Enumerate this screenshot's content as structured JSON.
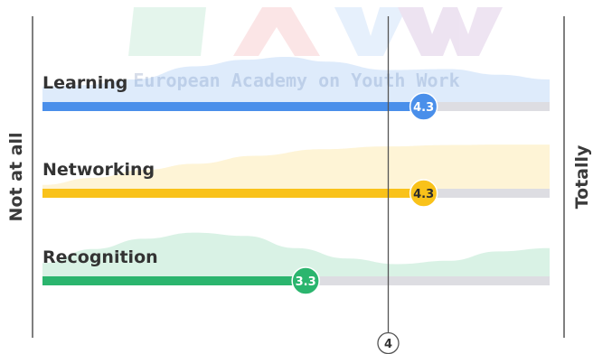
{
  "watermark": {
    "logo_letters": "EAYW",
    "text": "European Academy on Youth Work"
  },
  "axis": {
    "left_label": "Not at all",
    "right_label": "Totally",
    "reference_value": "4"
  },
  "colors": {
    "learning": "#4a8fea",
    "networking": "#f9c21a",
    "recognition": "#2bb56e",
    "track": "#dddde2",
    "axis": "#555555"
  },
  "chart_data": {
    "type": "bar",
    "orientation": "horizontal",
    "categories": [
      "Learning",
      "Networking",
      "Recognition"
    ],
    "values": [
      4.3,
      4.3,
      3.3
    ],
    "value_labels": [
      "4.3",
      "4.3",
      "3.3"
    ],
    "xlim": [
      1,
      5
    ],
    "reference_line": 4,
    "distribution_curves": true
  }
}
